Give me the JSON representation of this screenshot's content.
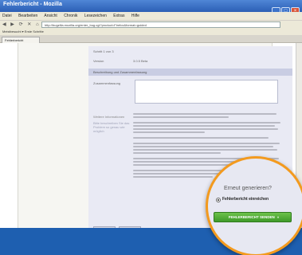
{
  "window": {
    "title": "Fehlerbericht - Mozilla",
    "buttons": [
      "_",
      "□",
      "×"
    ]
  },
  "menu": {
    "items": [
      "Datei",
      "Bearbeiten",
      "Ansicht",
      "Chronik",
      "Lesezeichen",
      "Extras",
      "Hilfe"
    ]
  },
  "nav": {
    "glyphs": "◀ ▶ ⟳ ✕ ⌂",
    "url": "http://bugzilla.mozilla.org/enter_bug.cgi?product=Firefox&format=guided"
  },
  "bookmarks": {
    "label": "Meistbesucht  ▾   Erste Schritte"
  },
  "tab": {
    "label": "Fehlerbericht"
  },
  "form": {
    "row1_label": "Schritt 1 von 3",
    "row2_label": "Version",
    "row2_value": "3.0.5 Beta",
    "band_label": "Beschreibung und Zusammenfassung",
    "desc_label": "Zusammenfassung",
    "side_label": "Weitere Informationen",
    "side_note": "Bitte beschreiben Sie das Problem so genau wie möglich",
    "buttons": [
      "Zurück",
      "Abbrechen"
    ]
  },
  "lens": {
    "question": "Erneut generieren?",
    "option": "Fehlerbericht einreichen",
    "submit": "FEHLERBERICHT SENDEN",
    "submit_icon": "»"
  }
}
